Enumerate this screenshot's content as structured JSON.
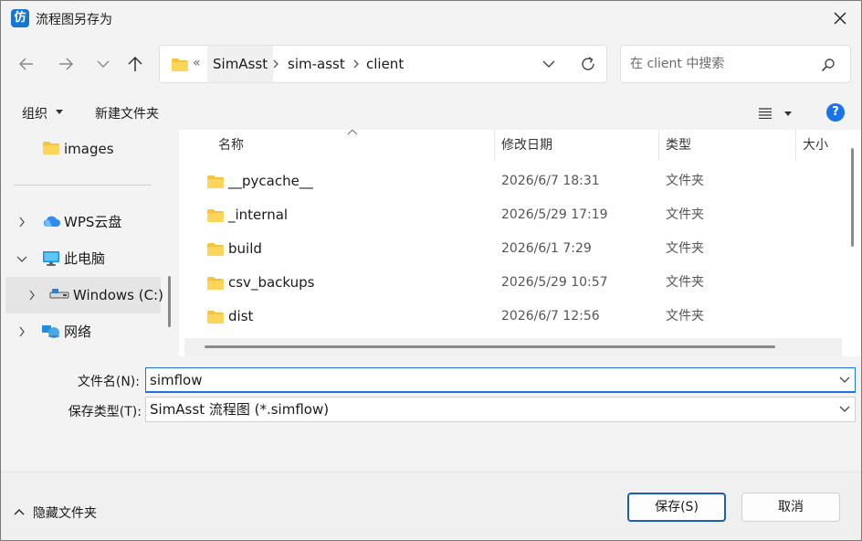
{
  "window": {
    "title": "流程图另存为",
    "app_icon_glyph": "仿"
  },
  "address": {
    "overflow": "«",
    "crumbs": [
      "SimAsst",
      "sim-asst",
      "client"
    ]
  },
  "search": {
    "placeholder": "在 client 中搜索"
  },
  "toolbar": {
    "organize_label": "组织",
    "new_folder_label": "新建文件夹",
    "help_glyph": "?"
  },
  "nav": {
    "items": [
      {
        "label": "images"
      },
      {
        "label": "WPS云盘"
      },
      {
        "label": "此电脑"
      },
      {
        "label": "Windows (C:)"
      },
      {
        "label": "网络"
      }
    ]
  },
  "columns": {
    "name": "名称",
    "modified": "修改日期",
    "type": "类型",
    "size": "大小"
  },
  "files": [
    {
      "name": "__pycache__",
      "modified": "2026/6/7 18:31",
      "type": "文件夹"
    },
    {
      "name": "_internal",
      "modified": "2026/5/29 17:19",
      "type": "文件夹"
    },
    {
      "name": "build",
      "modified": "2026/6/1 7:29",
      "type": "文件夹"
    },
    {
      "name": "csv_backups",
      "modified": "2026/5/29 10:57",
      "type": "文件夹"
    },
    {
      "name": "dist",
      "modified": "2026/6/7 12:56",
      "type": "文件夹"
    }
  ],
  "form": {
    "filename_label": "文件名(N):",
    "filename_value": "simflow",
    "filetype_label": "保存类型(T):",
    "filetype_value": "SimAsst 流程图 (*.simflow)"
  },
  "footer": {
    "hide_folders_label": "隐藏文件夹",
    "save_label": "保存(S)",
    "cancel_label": "取消"
  },
  "colors": {
    "accent": "#1a73e8",
    "folder": "#f8c33b",
    "primary_border": "#1a5fb4"
  }
}
